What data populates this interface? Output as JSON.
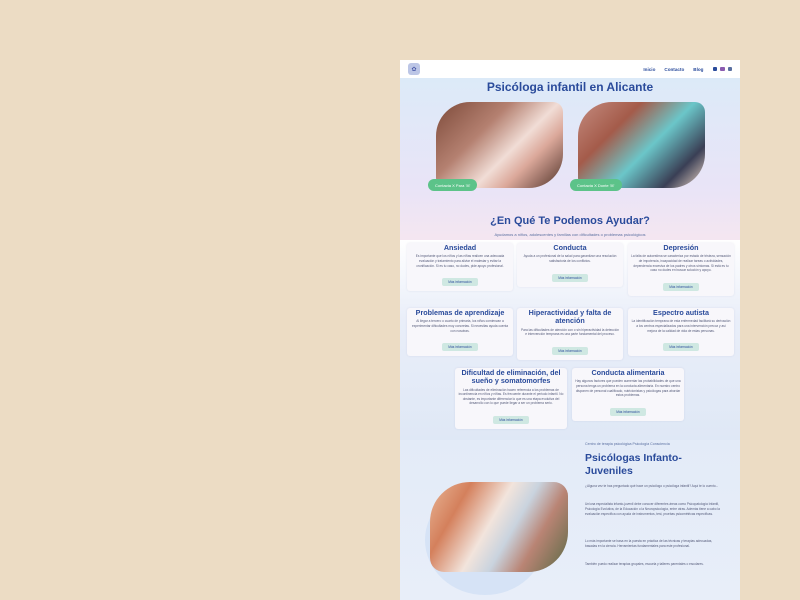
{
  "nav": {
    "logo_text": "✿",
    "links": [
      "Inicio",
      "Contacto",
      "Blog"
    ],
    "social_colors": [
      "#2a4b9b",
      "#8a5bb0",
      "#5a6fa0"
    ]
  },
  "hero": {
    "title": "Psicóloga infantil en Alicante",
    "button_a": "Contacta X Para ☏",
    "button_b": "Contacta X Donte ☏"
  },
  "help": {
    "title": "¿En Qué Te Podemos Ayudar?",
    "subtitle": "Ayudamos a niños, adolescentes y familias con dificultades o problemas psicológicos"
  },
  "services": [
    {
      "title": "Ansiedad",
      "text": "Es importante que los niños y las niñas realicen una adecuada evaluación y tratamiento para aliviar el malestar y evitar la cronificación. Si es tu caso, no dudes, pide apoyo profesional.",
      "button": "Más información"
    },
    {
      "title": "Conducta",
      "text": "Ayuda a un profesional de la salud para garantizar una resolución satisfactoria de los conflictos.",
      "button": "Más información"
    },
    {
      "title": "Depresión",
      "text": "La falta de autoestima se caracteriza por estado de tristeza, sensación de impotencia, incapacidad de realizar tareas o actividades, dependencia excesiva de los padres y otros síntomas. Si está es tu caso no dudes en buscar solución y apoyo.",
      "button": "Más información"
    },
    {
      "title": "Problemas de aprendizaje",
      "text": "Al llegar a tercero o cuarto de primaria, los niños comienzan a experimentar dificultades muy concretas. Si necesitas ayuda cuenta con nosotras.",
      "button": "Más información"
    },
    {
      "title": "Hiperactividad y falta de atención",
      "text": "Para las dificultades de atención con o sin hiperactividad la detección e intervención temprana es una parte fundamental del proceso.",
      "button": "Más información"
    },
    {
      "title": "Espectro autista",
      "text": "La identificación temprana de esta enfermedad facilitará su derivación a los centros especializados para una intervención precoz y así mejora de la calidad de vida de estas personas.",
      "button": "Más información"
    },
    {
      "title": "Dificultad de eliminación, del sueño y somatomorfes",
      "text": "Las dificultades de eliminación hacen referencia a los problemas de incontinencia en niños y niñas. Es frecuente durante el periodo infantil. No obstante, es importante diferenciar lo que es una etapa evolutiva del desarrollo con lo que puede llegar a ser un problema serio.",
      "button": "Más información"
    },
    {
      "title": "Conducta alimentaria",
      "text": "Hay algunos factores que pueden aumentar las probabilidades de que una persona tenga un problema en la conducta alimentaria. En nuestro centro disponen de personal cualificado, nutricionistas y psicólogas para abordar estos problemas.",
      "button": "Más información"
    }
  ],
  "lower": {
    "center_label": "Centro de terapia psicológica Psicología Consciencia",
    "title": "Psicólogas Infanto-Juveniles",
    "paragraphs": [
      "¿Alguna vez te has preguntado qué hace un psicólogo o psicóloga infantil? Aquí te lo cuento...",
      "Un/una especialista infanto-juvenil debe conocer diferentes áreas como Psicopatología Infantil, Psicología Evolutiva, de la Educación o la Neuropsicología, entre otras. Además tiene a cabo la evaluación específica con ayuda de instrumentos, test, pruebas psicométricas específicas.",
      "Lo más importante se basa en la puesta en práctica de las técnicas y terapias adecuadas, basadas en la ciencia. Herramientas fundamentales para este profesional.",
      "También puedo realizar terapias grupales, escuela y talleres parentales o escolares."
    ]
  }
}
